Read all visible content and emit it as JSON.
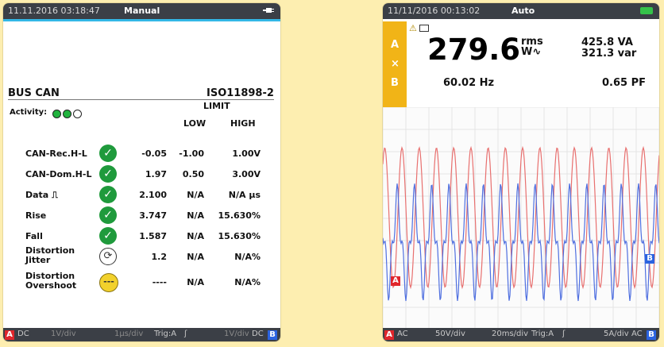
{
  "left": {
    "datetime": "11.11.2016 03:18:47",
    "mode": "Manual",
    "bus_title": "BUS CAN",
    "standard": "ISO11898-2",
    "limit_label": "LIMIT",
    "low_label": "LOW",
    "high_label": "HIGH",
    "activity_label": "Activity:",
    "activity_dots": [
      "#21b33e",
      "#21b33e",
      "#ffffff"
    ],
    "rows": [
      {
        "name": "CAN-Rec.H-L",
        "status": "ok",
        "value": "-0.05",
        "low": "-1.00",
        "high": "1.00V"
      },
      {
        "name": "CAN-Dom.H-L",
        "status": "ok",
        "value": "1.97",
        "low": "0.50",
        "high": "3.00V"
      },
      {
        "name": "Data ⎍",
        "status": "ok",
        "value": "2.100",
        "low": "N/A",
        "high": "N/A µs"
      },
      {
        "name": "Rise",
        "status": "ok",
        "value": "3.747",
        "low": "N/A",
        "high": "15.630%"
      },
      {
        "name": "Fall",
        "status": "ok",
        "value": "1.587",
        "low": "N/A",
        "high": "15.630%"
      },
      {
        "name": "Distortion",
        "name2": "Jitter",
        "status": "sync",
        "value": "1.2",
        "low": "N/A",
        "high": "N/A%"
      },
      {
        "name": "Distortion",
        "name2": "Overshoot",
        "status": "warn",
        "value": "----",
        "low": "N/A",
        "high": "N/A%"
      }
    ],
    "footer": {
      "a": "A",
      "a_coupling": "DC",
      "a_scale": "1V/div",
      "time": "1µs/div",
      "trig": "Trig:A",
      "b_scale": "1V/div",
      "b_coupling": "DC",
      "b": "B"
    }
  },
  "right": {
    "datetime": "11/11/2016 00:13:02",
    "mode": "Auto",
    "side_labels": [
      "A",
      "×",
      "B"
    ],
    "main_value": "279.6",
    "main_unit_top": "rms",
    "main_unit_bottom": "W∿",
    "va": "425.8 VA",
    "var": "321.3 var",
    "freq": "60.02 Hz",
    "pf": "0.65 PF",
    "marker_a": "A",
    "marker_b": "B",
    "footer": {
      "a": "A",
      "a_coupling": "AC",
      "a_scale": "50V/div",
      "time": "20ms/div",
      "trig": "Trig:A",
      "b_scale": "5A/div",
      "b_coupling": "AC",
      "b": "B"
    },
    "colors": {
      "voltage": "#e8706f",
      "current": "#4f6fe0",
      "battery": "#35c24a"
    }
  }
}
